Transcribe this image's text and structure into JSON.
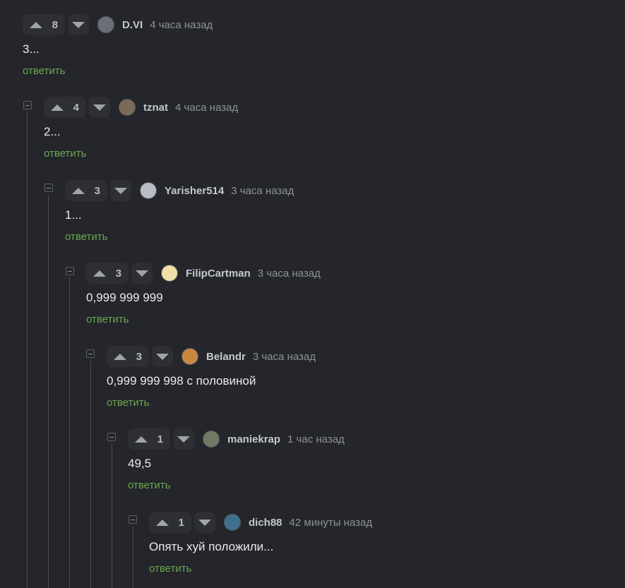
{
  "comments": [
    {
      "rating": "8",
      "author": "D.VI",
      "time": "4 часа назад",
      "text": "3...",
      "reply": "ответить",
      "avatar_color": "#6b6e75"
    },
    {
      "rating": "4",
      "author": "tznat",
      "time": "4 часа назад",
      "text": "2...",
      "reply": "ответить",
      "avatar_color": "#7a6a58"
    },
    {
      "rating": "3",
      "author": "Yarisher514",
      "time": "3 часа назад",
      "text": "1...",
      "reply": "ответить",
      "avatar_color": "#b9bcc4"
    },
    {
      "rating": "3",
      "author": "FilipCartman",
      "time": "3 часа назад",
      "text": "0,999 999 999",
      "reply": "ответить",
      "avatar_color": "#f1dfa6"
    },
    {
      "rating": "3",
      "author": "Belandr",
      "time": "3 часа назад",
      "text": "0,999 999 998 с половиной",
      "reply": "ответить",
      "avatar_color": "#c9883f"
    },
    {
      "rating": "1",
      "author": "maniekrap",
      "time": "1 час назад",
      "text": "49,5",
      "reply": "ответить",
      "avatar_color": "#6f7a63"
    },
    {
      "rating": "1",
      "author": "dich88",
      "time": "42 минуты назад",
      "text": "Опять хуй положили...",
      "reply": "ответить",
      "avatar_color": "#3e6f8f"
    }
  ],
  "colors": {
    "background": "#24262b",
    "reply_link": "#6aa84f",
    "thread_line": "#4a4d54"
  },
  "icons": {
    "upvote": "triangle-up",
    "downvote": "triangle-down",
    "collapse": "minus-square"
  }
}
